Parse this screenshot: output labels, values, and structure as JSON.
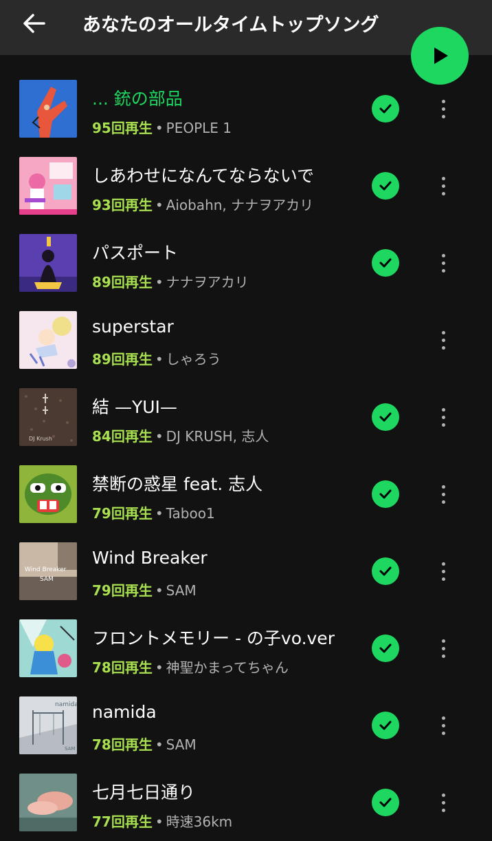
{
  "header": {
    "title": "あなたのオールタイムトップソング",
    "back_icon": "arrow-left-icon",
    "play_icon": "play-icon"
  },
  "colors": {
    "accent": "#1ed760",
    "plays_text": "#a8e04f",
    "background": "#121212",
    "header_bg": "#2a2a2a",
    "secondary_text": "#b3b3b3"
  },
  "tracks": [
    {
      "title": "... 銃の部品",
      "plays": "95回再生",
      "artist": "PEOPLE 1",
      "playing": true,
      "saved": true
    },
    {
      "title": "しあわせになんてならないで",
      "plays": "93回再生",
      "artist": "Aiobahn, ナナヲアカリ",
      "playing": false,
      "saved": true
    },
    {
      "title": "パスポート",
      "plays": "89回再生",
      "artist": "ナナヲアカリ",
      "playing": false,
      "saved": true
    },
    {
      "title": "superstar",
      "plays": "89回再生",
      "artist": "しゃろう",
      "playing": false,
      "saved": false
    },
    {
      "title": "結 —YUI—",
      "plays": "84回再生",
      "artist": "DJ KRUSH, 志人",
      "playing": false,
      "saved": true
    },
    {
      "title": "禁断の惑星 feat. 志人",
      "plays": "79回再生",
      "artist": "Taboo1",
      "playing": false,
      "saved": true
    },
    {
      "title": "Wind Breaker",
      "plays": "79回再生",
      "artist": "SAM",
      "playing": false,
      "saved": true
    },
    {
      "title": "フロントメモリー - の子vo.ver",
      "plays": "78回再生",
      "artist": "神聖かまってちゃん",
      "playing": false,
      "saved": true
    },
    {
      "title": "namida",
      "plays": "78回再生",
      "artist": "SAM",
      "playing": false,
      "saved": true
    },
    {
      "title": "七月七日通り",
      "plays": "77回再生",
      "artist": "時速36km",
      "playing": false,
      "saved": true
    }
  ],
  "cover_text": {
    "track_5": "DJ Krush",
    "track_7_line1": "Wind Breaker",
    "track_7_line2": "SAM",
    "track_9_title": "namida",
    "track_9_artist": "SAM"
  }
}
